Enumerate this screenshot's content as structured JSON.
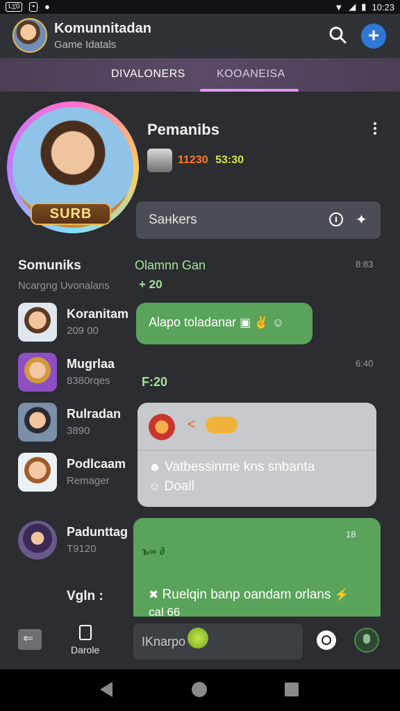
{
  "status_bar": {
    "left_icons": [
      "sim-icon",
      "notification-icon",
      "media-icon"
    ],
    "sim_label": "L፲0",
    "time": "10:23"
  },
  "header": {
    "title": "Komunnitadan",
    "subtitle": "Game Idatals",
    "accent": "#2f78d6"
  },
  "tabs": [
    {
      "label": "DIVALONERS",
      "active": false
    },
    {
      "label": "KOOANEISA",
      "active": true
    }
  ],
  "profile": {
    "badge": "SURB",
    "name": "Pemanibs",
    "score_a": "11230",
    "score_b": "53:30"
  },
  "search": {
    "placeholder": "Saнkers"
  },
  "section": {
    "title": "Somuniks",
    "subtitle": "Ncargng Uvonalans"
  },
  "channel": {
    "title": "Olamnn Gan",
    "subtitle": "+ 20",
    "timestamp": "8:83"
  },
  "contacts": [
    {
      "name": "Koranitam",
      "sub": "209 00"
    },
    {
      "name": "Mugrlaa",
      "sub": "8380rqes"
    },
    {
      "name": "Rulradan",
      "sub": "3890"
    },
    {
      "name": "Podlcaam",
      "sub": "Remager"
    },
    {
      "name": "Padunttag",
      "sub": "T9120"
    }
  ],
  "messages": {
    "green1": "Alapo toladanar",
    "timestamp2": "6:40",
    "green_num": "F:20",
    "grey_row1": "<",
    "grey_row2": "Vatbessinme kns snbanta",
    "grey_row3": "Doall",
    "green2_time": "18",
    "green2_dots": "ъ∞ ∂",
    "green2_msg": "Ruelqin banp oandam orlans",
    "green2_msg2": "cal 66"
  },
  "vgin_label": "Vgln :",
  "bottom_bar": {
    "doc_label": "Darole",
    "input_value": "IKnarpo"
  }
}
